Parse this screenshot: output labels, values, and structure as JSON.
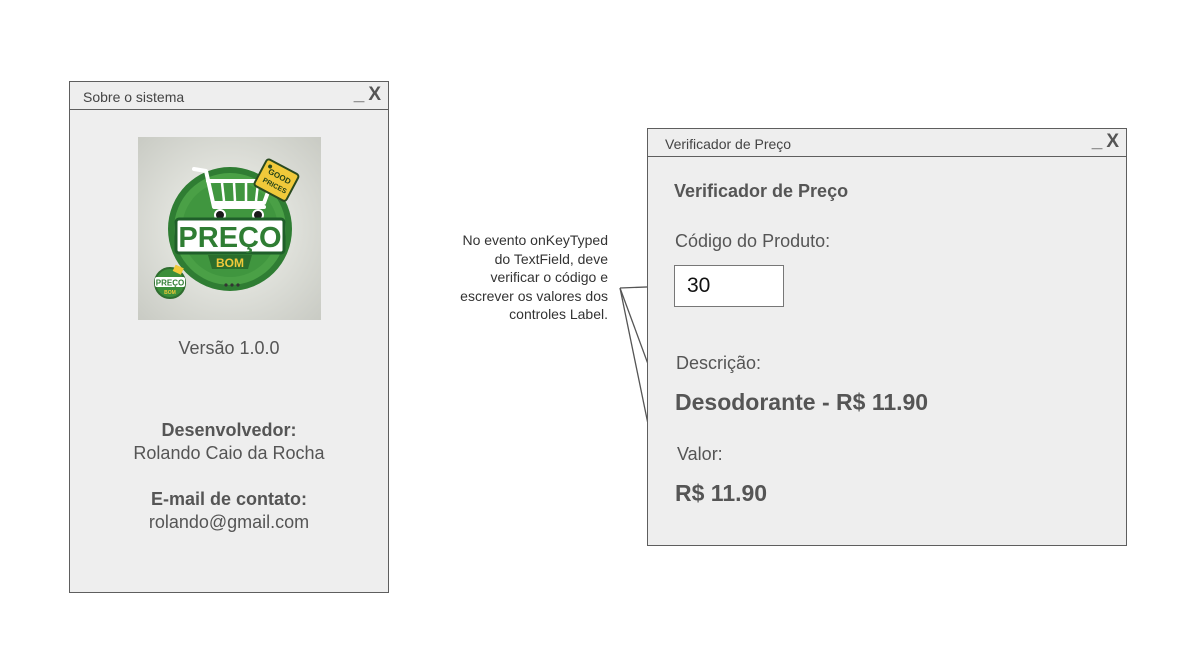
{
  "about_window": {
    "title": "Sobre o sistema",
    "minimize": "_",
    "close": "X",
    "logo": {
      "tag_text_1": "GOOD",
      "tag_text_2": "PRICES",
      "main_text": "PREÇO",
      "sub_text": "BOM",
      "small_main": "PREÇO",
      "small_sub": "BOM"
    },
    "version": "Versão 1.0.0",
    "developer_label": "Desenvolvedor:",
    "developer_name": "Rolando Caio da Rocha",
    "email_label": "E-mail de contato:",
    "email": "rolando@gmail.com"
  },
  "annotation": {
    "text": "No evento onKeyTyped do TextField, deve verificar o código e escrever os valores dos controles Label."
  },
  "price_window": {
    "title": "Verificador de Preço",
    "minimize": "_",
    "close": "X",
    "heading": "Verificador de Preço",
    "code_label": "Código do Produto:",
    "code_value": "30",
    "description_label": "Descrição:",
    "description_value": "Desodorante - R$ 11.90",
    "value_label": "Valor:",
    "value_value": "R$ 11.90"
  },
  "colors": {
    "window_bg": "#eeeeee",
    "border": "#5e5e5e",
    "logo_green": "#3b8f3a",
    "logo_dark_green": "#1f5f2a",
    "tag_yellow": "#f0c93a"
  }
}
